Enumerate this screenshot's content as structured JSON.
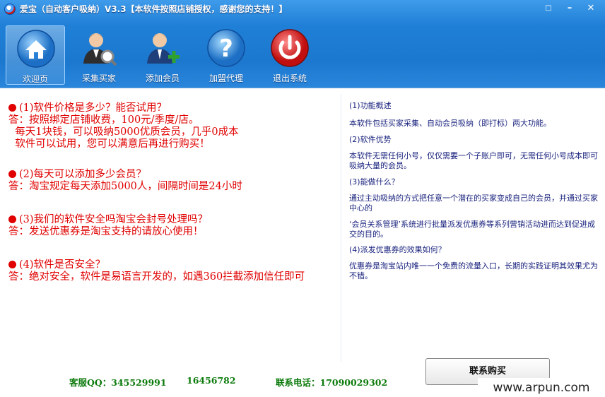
{
  "window": {
    "title": "爱宝（自动客户吸纳）V3.3【本软件按照店铺授权，感谢您的支持！】",
    "menu_icon": "□",
    "minimize_icon": "–",
    "close_icon": "✕"
  },
  "toolbar": [
    {
      "label": "欢迎页",
      "icon": "house-icon"
    },
    {
      "label": "采集买家",
      "icon": "user-search-icon"
    },
    {
      "label": "添加会员",
      "icon": "user-add-icon"
    },
    {
      "label": "加盟代理",
      "icon": "question-icon"
    },
    {
      "label": "退出系统",
      "icon": "power-icon"
    }
  ],
  "faq": [
    {
      "q": "(1)软件价格是多少？能否试用？",
      "a": [
        "答：按照绑定店铺收费，100元/季度/店。",
        "  每天1块钱，可以吸纳5000优质会员，几乎0成本",
        "  软件可以试用，您可以满意后再进行购买！"
      ]
    },
    {
      "q": "(2)每天可以添加多少会员？",
      "a": [
        "答：淘宝规定每天添加5000人，间隔时间是24小时"
      ]
    },
    {
      "q": "(3)我们的软件安全吗淘宝会封号处理吗？",
      "a": [
        "答：发送优惠券是淘宝支持的请放心使用！"
      ]
    },
    {
      "q": "(4)软件是否安全？",
      "a": [
        "答：绝对安全，软件是易语言开发的，如遇360拦截添加信任即可"
      ]
    }
  ],
  "info": [
    {
      "h": "(1)功能概述",
      "t": "本软件包括买家采集、自动会员吸纳（即打标）两大功能。"
    },
    {
      "h": "(2)软件优势",
      "t": "本软件无需任何小号，仅仅需要一个子账户即可，无需任何小号成本即可吸纳大量的会员。"
    },
    {
      "h": "(3)能做什么？",
      "t": "通过主动吸纳的方式把任意一个潜在的买家变成自己的会员，并通过买家中心的"
    },
    {
      "h": "",
      "t": "‘会员关系管理’系统进行批量派发优惠券等系列营销活动进而达到促进成交的目的。"
    },
    {
      "h": "(4)派发优惠券的效果如何？",
      "t": "优惠券是淘宝站内唯一一个免费的流量入口，长期的实践证明其效果尤为不错。"
    }
  ],
  "footer": {
    "qq_label": "客服QQ：",
    "qq1": "345529991",
    "qq2": "16456782",
    "phone_label": "联系电话：",
    "phone": "17090029302",
    "buy_button": "联系购买"
  },
  "watermark": "www.arpun.com"
}
